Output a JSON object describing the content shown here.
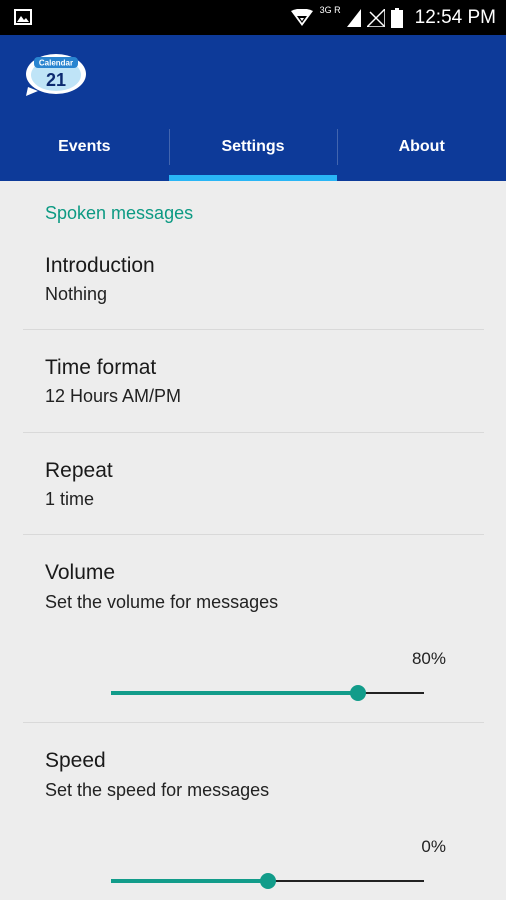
{
  "status_bar": {
    "network_label": "3G R",
    "time": "12:54 PM",
    "icons": [
      "gallery-icon",
      "hotspot-icon",
      "signal-icon",
      "no-signal-icon",
      "battery-icon"
    ]
  },
  "app_bar": {
    "logo_text": "Calendar",
    "logo_day": "21"
  },
  "tabs": [
    {
      "label": "Events",
      "active": false
    },
    {
      "label": "Settings",
      "active": true
    },
    {
      "label": "About",
      "active": false
    }
  ],
  "settings": {
    "section_header": "Spoken messages",
    "introduction": {
      "title": "Introduction",
      "summary": "Nothing"
    },
    "time_format": {
      "title": "Time format",
      "summary": "12 Hours AM/PM"
    },
    "repeat": {
      "title": "Repeat",
      "summary": "1 time"
    },
    "volume": {
      "title": "Volume",
      "summary": "Set the volume for messages",
      "value_label": "80%",
      "level": 0.79
    },
    "speed": {
      "title": "Speed",
      "summary": "Set the speed for messages",
      "value_label": "0%",
      "level": 0.5
    }
  },
  "colors": {
    "app_bar": "#0d3a99",
    "tab_indicator": "#29b6f6",
    "accent": "#129c8a",
    "section_header": "#0c9a83"
  }
}
